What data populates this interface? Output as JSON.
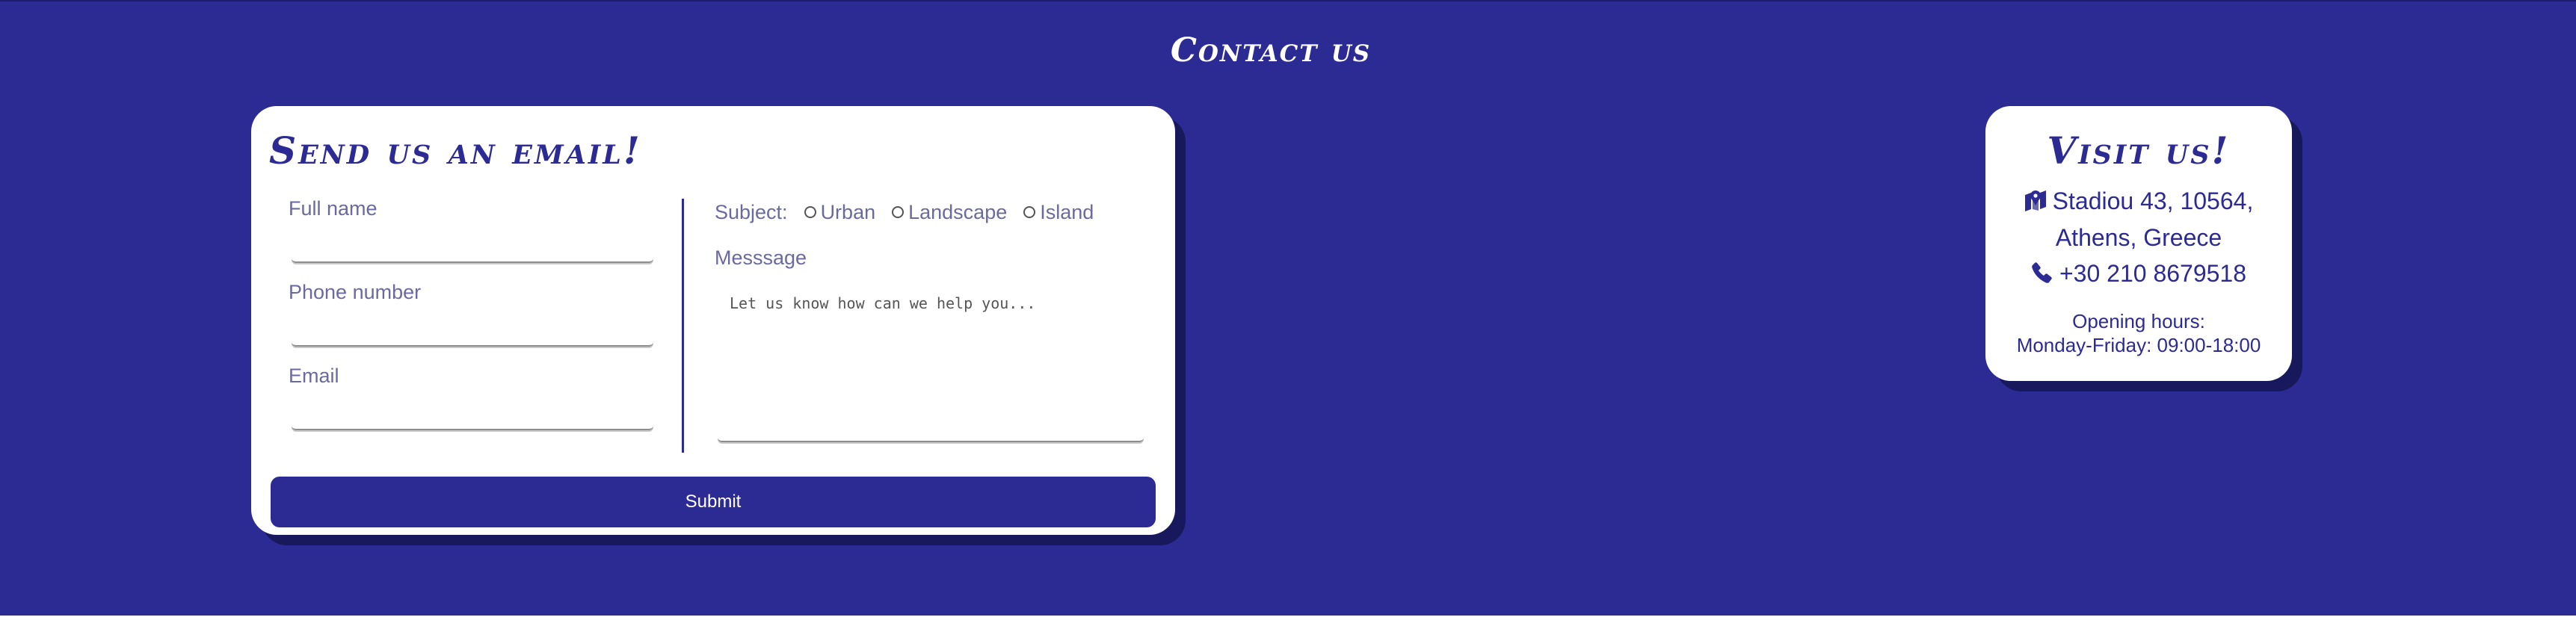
{
  "section": {
    "title": "Contact us"
  },
  "email_form": {
    "title": "Send us an email!",
    "fields": [
      {
        "label": "Full name",
        "value": ""
      },
      {
        "label": "Phone number",
        "value": ""
      },
      {
        "label": "Email",
        "value": ""
      }
    ],
    "subject": {
      "label": "Subject:",
      "options": [
        "Urban",
        "Landscape",
        "Island"
      ]
    },
    "message": {
      "label": "Messsage",
      "placeholder": "Let us know how can we help you..."
    },
    "submit_label": "Submit"
  },
  "visit": {
    "title": "Visit us!",
    "address_line1": "Stadiou 43, 10564,",
    "address_line2": "Athens, Greece",
    "phone": "+30 210 8679518",
    "hours_label": "Opening hours:",
    "hours_value": "Monday-Friday: 09:00-18:00",
    "icons": {
      "address": "map-marker-icon",
      "phone": "phone-icon"
    }
  },
  "colors": {
    "brand": "#2c2a93",
    "card": "#ffffff",
    "label": "#6a6a9e"
  }
}
